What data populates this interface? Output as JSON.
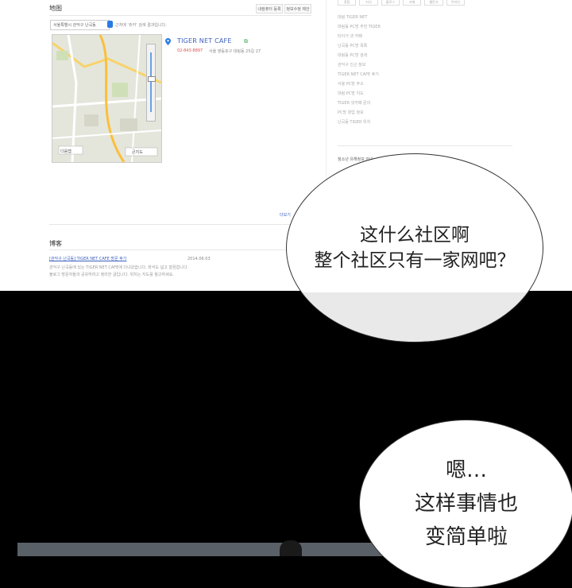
{
  "top_panel": {
    "map_section_title": "地图",
    "map_buttons": [
      "내컴퓨터 등록",
      "정보수정 제안"
    ],
    "address_input": "서울특별시 관악구 난곡동",
    "address_note": "근처에 ‘쥬카’ 검색 결과입니다.",
    "place_name": "TIGER NET CAFE",
    "place_phone": "02-843-8897",
    "place_address": "서울 영등포구 대림동 25길 27",
    "map_footer_left": "다음맵",
    "map_footer_right": "큰지도",
    "right_tabs": [
      "종합",
      "지식",
      "블로그",
      "카페",
      "웹문서",
      "이미지"
    ],
    "right_list": [
      "대림 TIGER NET",
      "대림동 PC방 추천 TIGER",
      "타이거 넷 카페",
      "난곡동 PC방 목록",
      "대림동 PC방 검색",
      "관악구 인근 정보",
      "TIGER NET CAFE 후기",
      "서울 PC방 주소",
      "대림 PC방 지도",
      "TIGER 넷카페 문의",
      "PC방 창업 정보",
      "난곡동 TIGER 위치"
    ],
    "right_subsection": "청소년 유해정보 안내",
    "blog_section_title": "博客",
    "blog_link": "[관악구 난곡동] TIGER NET CAFE 방문 후기",
    "blog_date": "2014.06.03",
    "blog_lines": [
      "관악구 난곡동에 있는 TIGER NET CAFE에 다녀왔습니다. 좌석도 넓고 깔끔합니다.",
      "블로그 방문자들과 공유하려고 정리한 글입니다. 위치는 지도를 참고하세요."
    ],
    "more_link": "더보기"
  },
  "bubbles": {
    "first": [
      "这什么社区啊",
      "整个社区只有一家网吧？"
    ],
    "second": [
      "嗯…",
      "这样事情也",
      "变简单啦"
    ]
  },
  "colors": {
    "link_blue": "#3a5fbf",
    "panel_bg": "#ffffff",
    "dark_bg": "#000000"
  }
}
